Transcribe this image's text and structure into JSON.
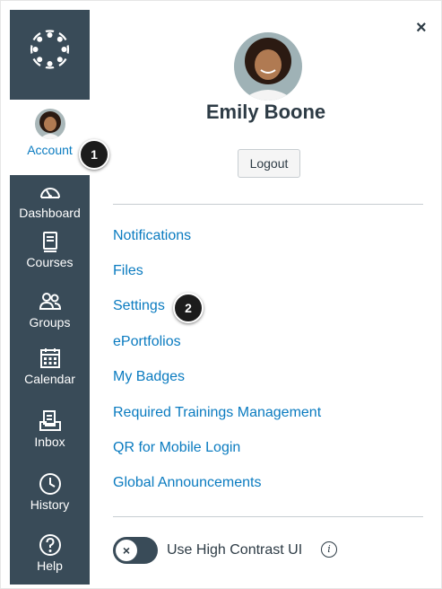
{
  "nav": {
    "items": [
      {
        "label": "Account",
        "icon": "user-avatar-icon"
      },
      {
        "label": "Dashboard",
        "icon": "speedometer-icon"
      },
      {
        "label": "Courses",
        "icon": "book-icon"
      },
      {
        "label": "Groups",
        "icon": "people-icon"
      },
      {
        "label": "Calendar",
        "icon": "calendar-icon"
      },
      {
        "label": "Inbox",
        "icon": "inbox-icon"
      },
      {
        "label": "History",
        "icon": "clock-icon"
      },
      {
        "label": "Help",
        "icon": "question-icon"
      }
    ]
  },
  "tray": {
    "user_name": "Emily Boone",
    "logout_label": "Logout",
    "close_label": "×",
    "links": [
      "Notifications",
      "Files",
      "Settings",
      "ePortfolios",
      "My Badges",
      "Required Trainings Management",
      "QR for Mobile Login",
      "Global Announcements"
    ],
    "contrast_label": "Use High Contrast UI",
    "toggle_knob": "×",
    "info_glyph": "i"
  },
  "callouts": [
    "1",
    "2"
  ],
  "colors": {
    "nav_bg": "#394b58",
    "link": "#0a7bc0",
    "text": "#2d3b45"
  }
}
